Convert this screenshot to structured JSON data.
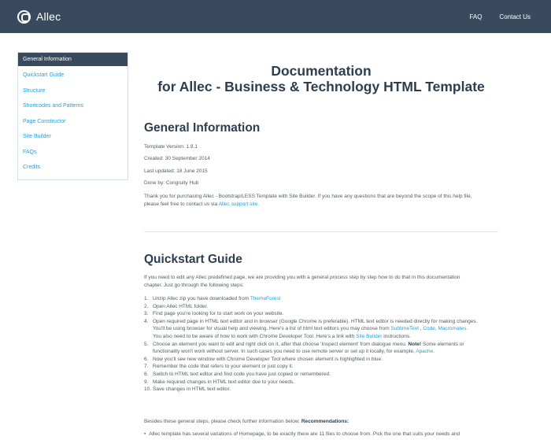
{
  "header": {
    "brand": "Allec",
    "nav": [
      {
        "label": "FAQ"
      },
      {
        "label": "Contact Us"
      }
    ]
  },
  "sidebar": {
    "items": [
      {
        "label": "General Information"
      },
      {
        "label": "Quickstart Guide"
      },
      {
        "label": "Structure"
      },
      {
        "label": "Shortcodes and Patterns"
      },
      {
        "label": "Page Constructor"
      },
      {
        "label": "Site Builder"
      },
      {
        "label": "FAQs"
      },
      {
        "label": "Credits"
      }
    ]
  },
  "doc": {
    "title_line1": "Documentation",
    "title_line2": "for Allec - Business & Technology HTML Template"
  },
  "general": {
    "heading": "General Information",
    "version": "Template Version: 1.9.1",
    "created": "Created: 30 September 2014",
    "updated": "Last updated: 18 June 2015",
    "done_by": "Done by: Congruity Hub",
    "thanks": "Thank you for purchasing Allec - Bootstrap/LESS Template with Site Builder. If you have any questions that are beyond the scope of this help file,",
    "thanks2": "please feel free to contact us via",
    "support_link": "Allec support site",
    "thanks_end": "."
  },
  "quickstart": {
    "heading": "Quickstart Guide",
    "intro1": "If you need to edit any Allec predefined page, we are providing you with a general process step by step how to do that in this documentation",
    "intro2": "chapter. Just go through the following steps:",
    "steps": [
      {
        "num": "1.",
        "text": "Unzip Allec zip you have downloaded from ",
        "link": "ThemeForest"
      },
      {
        "num": "2.",
        "text": "Open Allec HTML folder."
      },
      {
        "num": "3.",
        "text": "Find page you're looking for to start work on your website."
      },
      {
        "num": "4.",
        "text": "Open required page in HTML text editor and in browser (Google Chrome is preferable). HTML text editor is needed directly for making changes."
      },
      {
        "num": "",
        "text": "You'll be using browser for visual help and viewing. Here's a list of html text editors you may choose from ",
        "link": "SublimeText",
        "sep1": " , ",
        "link2": "Code",
        "sep2": ", ",
        "link3": "Macromates",
        "end": "."
      },
      {
        "num": "",
        "text": "You also need to be aware of how to work with Chrome Developer Tool. Here's a link with ",
        "link": "Site Builder",
        "end": " instructions."
      },
      {
        "num": "5.",
        "text": "Choose an element you want to edit and right click on it, after that choose 'Inspect element' from dialogue menu. ",
        "bold": "Note!",
        "end": " Some elements or"
      },
      {
        "num": "",
        "text": "functionality won't work without server. In such cases you need to use remote server or set up it locally, for example, ",
        "link": "Apache",
        "end": "."
      },
      {
        "num": "6.",
        "text": "Now you'll see new window with Chrome Developer Tool where chosen element is highlighted in blue."
      },
      {
        "num": "7.",
        "text": "Remember the code that refers to your element or just copy it."
      },
      {
        "num": "8.",
        "text": "Switch to HTML text editor and find code you have just copied or remembered."
      },
      {
        "num": "9.",
        "text": "Make required changes in HTML text editor due to your needs."
      },
      {
        "num": "10.",
        "text": "Save changes in HTML text editor."
      }
    ],
    "besides": "Besides these general steps, please check further information below. ",
    "recommendations": "Recommendations:",
    "bullet1": "Allec template has several variations of Homepage, to be exactly there are 11 files to choose from. Pick the one that suits your needs and"
  }
}
